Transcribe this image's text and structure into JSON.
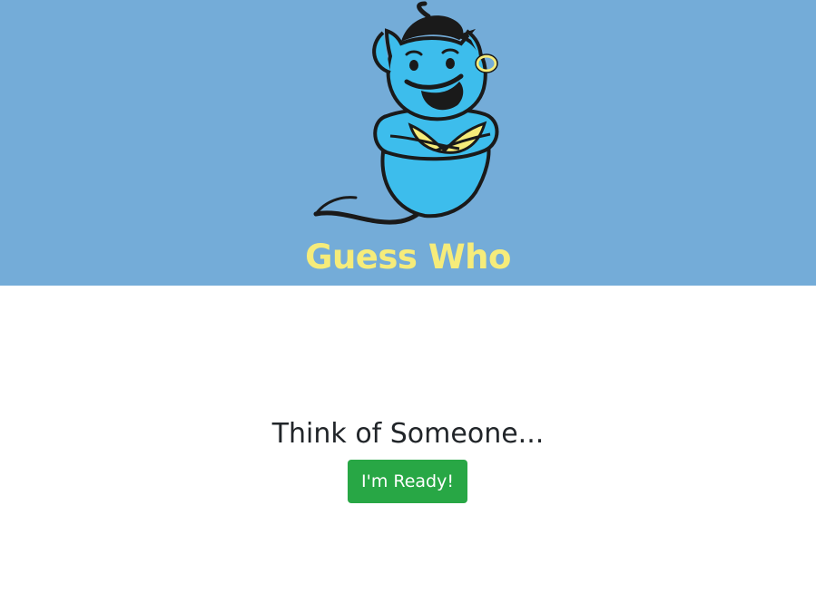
{
  "banner": {
    "logo_icon": "genie-mascot-icon",
    "title": "Guess Who",
    "background_color": "#74acd8",
    "title_color": "#f6ec7a"
  },
  "main": {
    "prompt": "Think of Someone...",
    "ready_button_label": "I'm Ready!",
    "button_color": "#28a745"
  }
}
